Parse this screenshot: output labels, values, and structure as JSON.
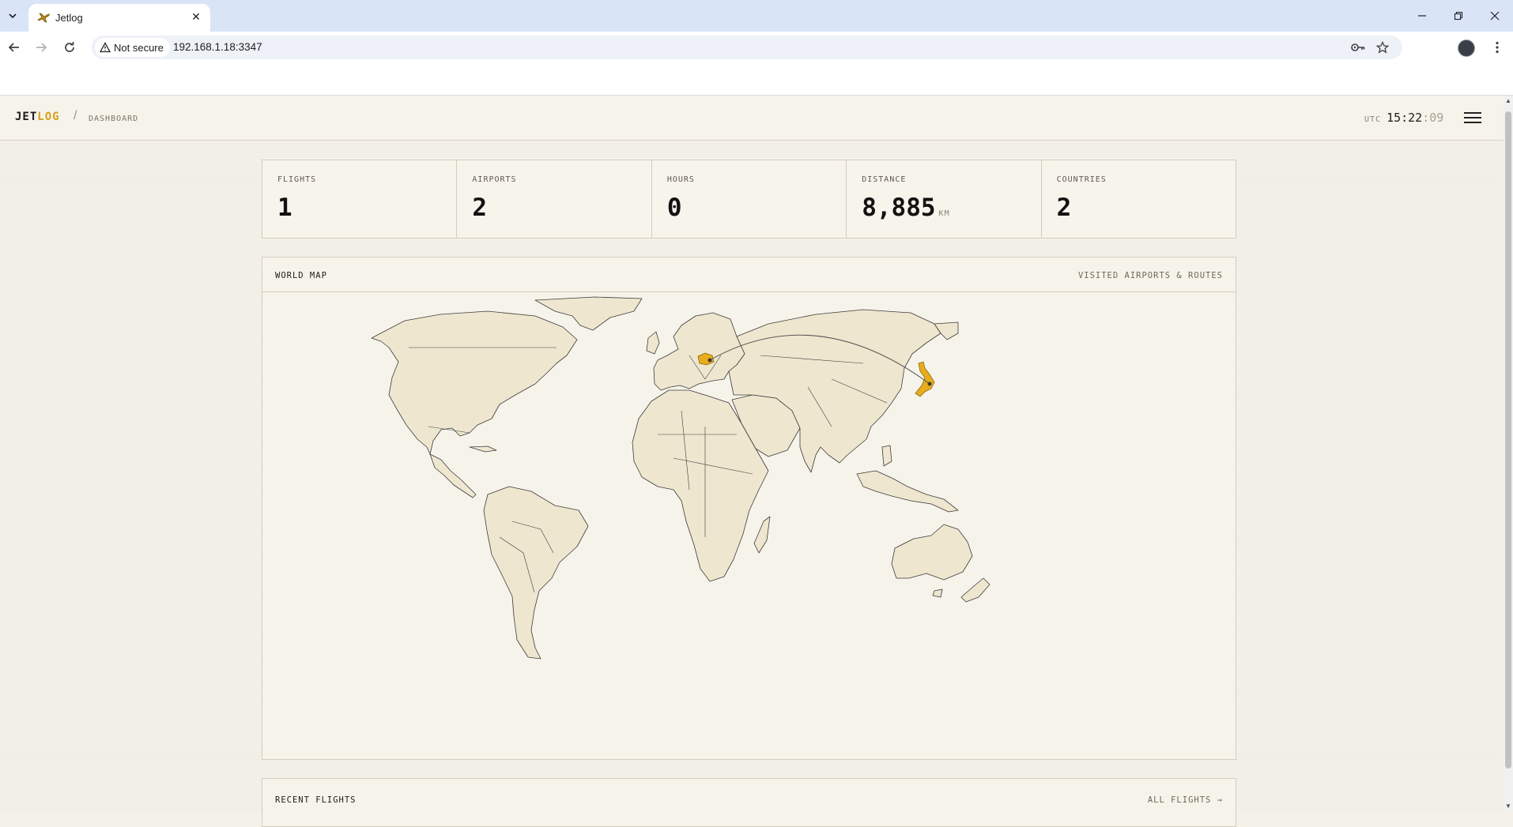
{
  "browser": {
    "tab_title": "Jetlog",
    "security_label": "Not secure",
    "url": "192.168.1.18:3347"
  },
  "app": {
    "brand_prefix": "JET",
    "brand_suffix": "LOG",
    "breadcrumb_separator": "/",
    "breadcrumb": "DASHBOARD",
    "clock": {
      "zone": "UTC",
      "hours_minutes": "15:22",
      "seconds": ":09"
    }
  },
  "stats": [
    {
      "label": "FLIGHTS",
      "value": "1",
      "unit": ""
    },
    {
      "label": "AIRPORTS",
      "value": "2",
      "unit": ""
    },
    {
      "label": "HOURS",
      "value": "0",
      "unit": ""
    },
    {
      "label": "DISTANCE",
      "value": "8,885",
      "unit": "KM"
    },
    {
      "label": "COUNTRIES",
      "value": "2",
      "unit": ""
    }
  ],
  "map": {
    "title": "WORLD MAP",
    "subtitle": "VISITED AIRPORTS & ROUTES",
    "visited_countries": [
      "Romania",
      "Japan"
    ],
    "colors": {
      "land": "#efe6cf",
      "border": "#3b3b3b",
      "visited": "#e8ac1c",
      "route": "#5a5a5a",
      "ocean": "#f6f3ea"
    }
  },
  "recent": {
    "title": "RECENT FLIGHTS",
    "link": "ALL FLIGHTS →"
  }
}
